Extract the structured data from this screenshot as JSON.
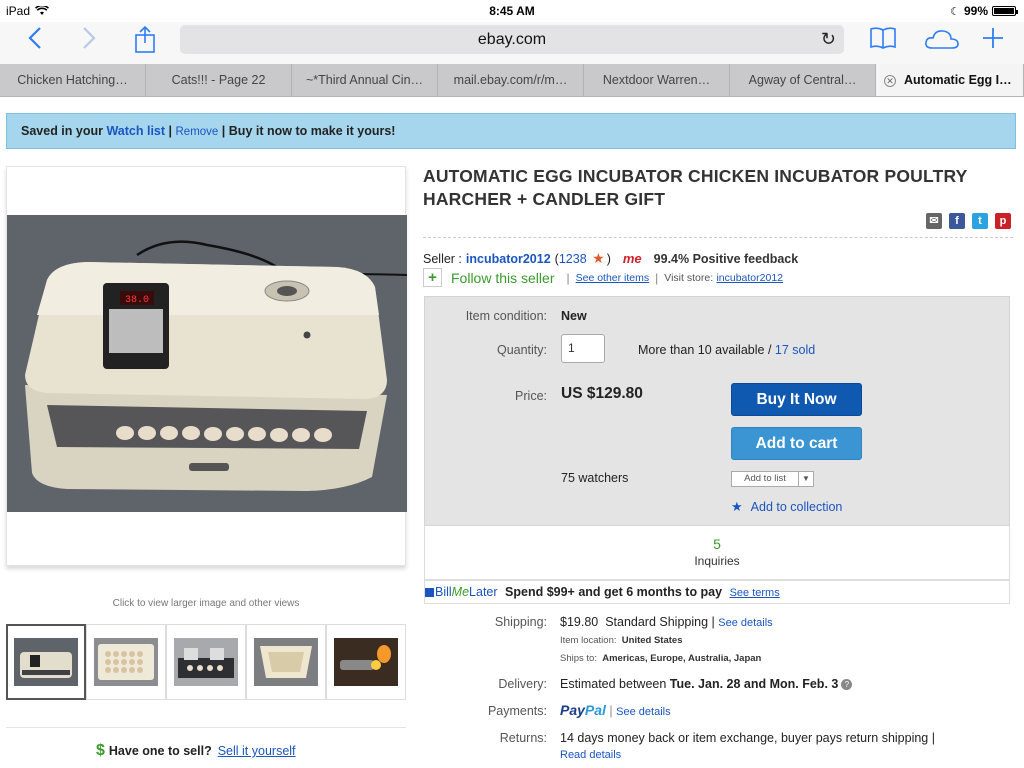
{
  "status": {
    "device": "iPad",
    "time": "8:45 AM",
    "battery": "99%"
  },
  "browser": {
    "address": "ebay.com",
    "tabs": [
      "Chicken Hatching…",
      "Cats!!! - Page 22",
      "~*Third Annual Cin…",
      "mail.ebay.com/r/m…",
      "Nextdoor Warren…",
      "Agway of Central…",
      "Automatic Egg I…"
    ]
  },
  "banner": {
    "prefix": "Saved in your",
    "watch_list": "Watch list",
    "remove": "Remove",
    "suffix": "Buy it now to make it yours!"
  },
  "gallery": {
    "hint": "Click to view larger image and other views",
    "display_reading": "38.0",
    "thumbnails": [
      "incubator-front",
      "incubator-eggs-top",
      "incubator-tray",
      "incubator-empty",
      "egg-candler"
    ]
  },
  "sell": {
    "question": "Have one to sell?",
    "link": "Sell it yourself"
  },
  "listing": {
    "title": "AUTOMATIC EGG INCUBATOR CHICKEN INCUBATOR POULTRY HARCHER + CANDLER GIFT",
    "seller_label": "Seller :",
    "seller_name": "incubator2012",
    "feedback_score": "1238",
    "me_badge": "me",
    "positive_feedback": "99.4% Positive feedback",
    "follow": "Follow this seller",
    "see_other": "See other items",
    "visit_store_label": "Visit store:",
    "store": "incubator2012",
    "condition_label": "Item condition:",
    "condition": "New",
    "quantity_label": "Quantity:",
    "quantity": "1",
    "available": "More than 10 available /",
    "sold": "17 sold",
    "price_label": "Price:",
    "price": "US $129.80",
    "buy_now": "Buy It Now",
    "add_to_cart": "Add to cart",
    "watchers": "75 watchers",
    "add_to_list": "Add to list",
    "add_to_collection": "Add to collection",
    "inquiries_count": "5",
    "inquiries_label": "Inquiries",
    "bml_bill": "Bill",
    "bml_me": "Me",
    "bml_later": "Later",
    "bml_text": "Spend $99+ and get 6 months to pay",
    "bml_terms": "See terms",
    "shipping_label": "Shipping:",
    "shipping_cost": "$19.80",
    "shipping_type": "Standard Shipping |",
    "see_details": "See details",
    "item_location_label": "Item location:",
    "item_location": "United States",
    "ships_to_label": "Ships to:",
    "ships_to": "Americas, Europe, Australia, Japan",
    "delivery_label": "Delivery:",
    "delivery_prefix": "Estimated between",
    "delivery_dates": "Tue. Jan. 28 and Mon. Feb. 3",
    "payments_label": "Payments:",
    "paypal_1": "Pay",
    "paypal_2": "Pal",
    "returns_label": "Returns:",
    "returns": "14 days money back or item exchange, buyer pays return shipping |",
    "read_details": "Read details"
  },
  "colors": {
    "link": "#1a55c0",
    "buy_now": "#0f5ab0",
    "add_to_cart": "#3a95d2",
    "banner": "#a6d6ed",
    "green": "#3a9b2b"
  }
}
